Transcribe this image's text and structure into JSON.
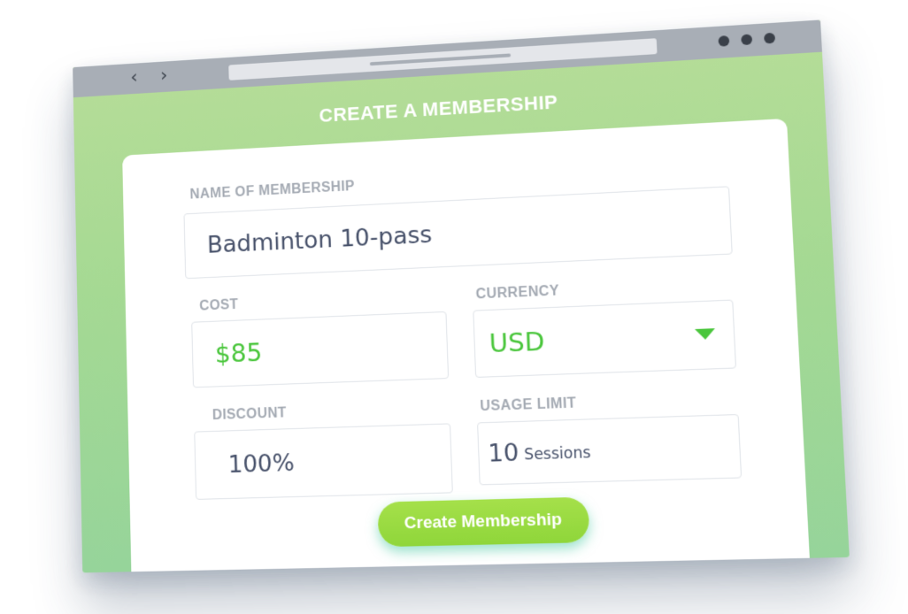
{
  "browser": {
    "back_glyph": "‹",
    "forward_glyph": "›",
    "icons": {
      "back": "chevron-left-icon",
      "forward": "chevron-right-icon",
      "menu": "window-dots-icon"
    }
  },
  "page": {
    "title": "CREATE A MEMBERSHIP"
  },
  "form": {
    "name": {
      "label": "NAME OF MEMBERSHIP",
      "value": "Badminton 10-pass"
    },
    "cost": {
      "label": "COST",
      "value": "$85"
    },
    "currency": {
      "label": "CURRENCY",
      "selected": "USD"
    },
    "discount": {
      "label": "DISCOUNT",
      "value": "100%"
    },
    "usage_limit": {
      "label": "USAGE LIMIT",
      "value": "10",
      "unit": "Sessions"
    },
    "submit_label": "Create Membership"
  },
  "colors": {
    "accent_green": "#4ac63c",
    "button_green": "#8fd63a",
    "background_green": "#a5d993",
    "text_dark": "#47516a",
    "label_gray": "#a4aab3"
  }
}
